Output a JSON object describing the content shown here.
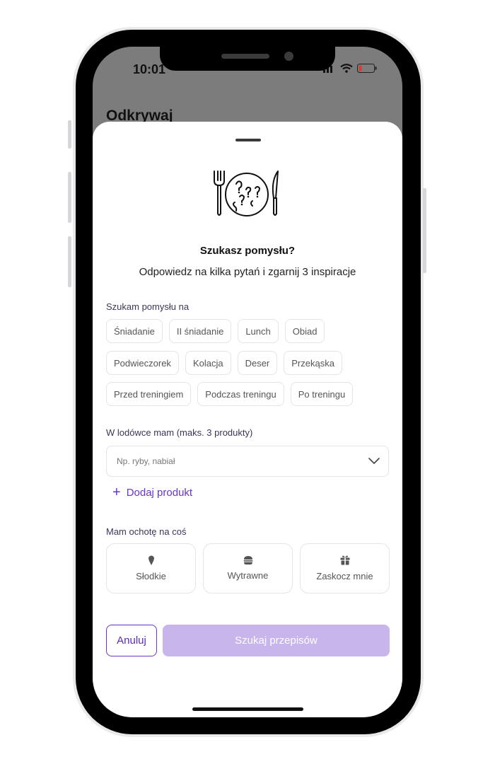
{
  "status_bar": {
    "time": "10:01"
  },
  "background_screen": {
    "title": "Odkrywaj"
  },
  "sheet": {
    "title": "Szukasz pomysłu?",
    "subtitle": "Odpowiedz na kilka pytań i zgarnij 3 inspiracje",
    "meal_section": {
      "label": "Szukam pomysłu na",
      "rows": [
        [
          "Śniadanie",
          "II śniadanie",
          "Lunch",
          "Obiad"
        ],
        [
          "Podwieczorek",
          "Kolacja",
          "Deser",
          "Przekąska"
        ],
        [
          "Przed treningiem",
          "Podczas treningu",
          "Po treningu"
        ]
      ]
    },
    "fridge_section": {
      "label": "W lodówce mam (maks. 3 produkty)",
      "placeholder": "Np. ryby, nabiał",
      "add_label": "Dodaj produkt"
    },
    "mood_section": {
      "label": "Mam ochotę na coś",
      "options": [
        {
          "label": "Słodkie",
          "icon": "ice-cream-icon"
        },
        {
          "label": "Wytrawne",
          "icon": "burger-icon"
        },
        {
          "label": "Zaskocz mnie",
          "icon": "gift-icon"
        }
      ]
    },
    "actions": {
      "cancel": "Anuluj",
      "search": "Szukaj przepisów"
    }
  },
  "colors": {
    "accent": "#6a35c9",
    "search_button_disabled": "#c8b5ec",
    "overlay": "#7c7c7c"
  }
}
